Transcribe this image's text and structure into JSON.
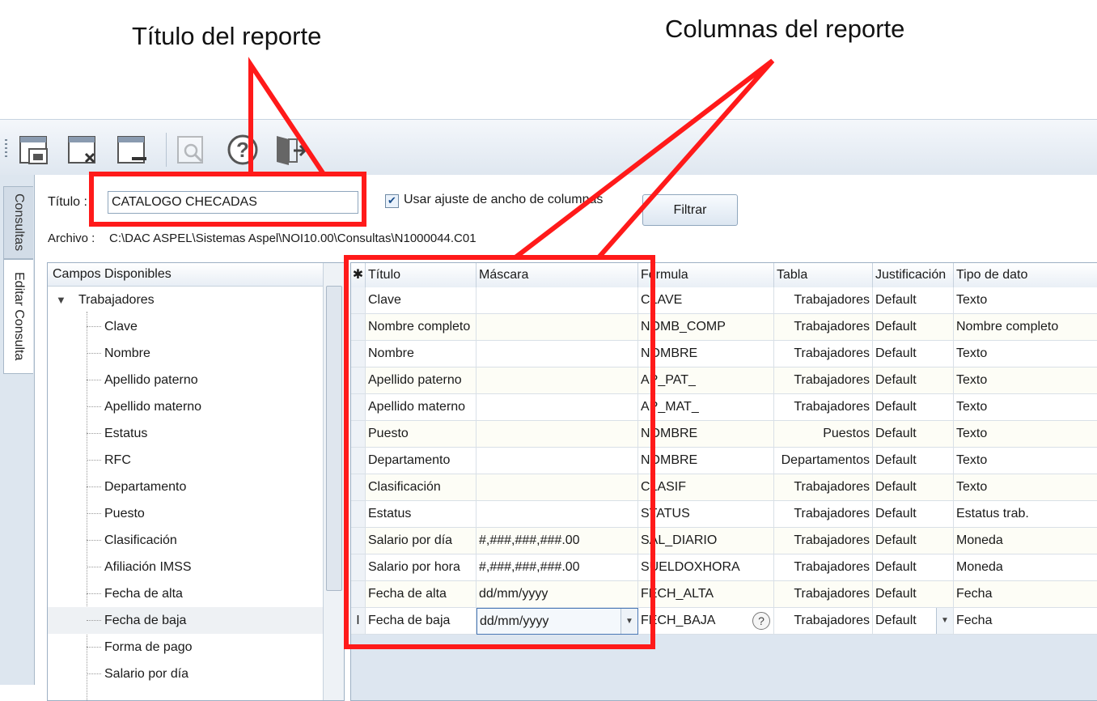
{
  "annotations": {
    "title_callout": "Título del reporte",
    "columns_callout": "Columnas del reporte"
  },
  "toolbar": {
    "icons": [
      "save-icon",
      "close-document-icon",
      "minimize-document-icon",
      "preview-icon",
      "help-icon",
      "exit-icon"
    ]
  },
  "sidebar": {
    "tab_consultas": "Consultas",
    "tab_editar": "Editar Consulta"
  },
  "form": {
    "titulo_label": "Título :",
    "titulo_value": "CATALOGO CHECADAS",
    "ajuste_label": "Usar ajuste de ancho de columnas",
    "ajuste_checked": true,
    "filtrar_label": "Filtrar",
    "archivo_label": "Archivo :",
    "archivo_path": "C:\\DAC ASPEL\\Sistemas Aspel\\NOI10.00\\Consultas\\N1000044.C01"
  },
  "tree": {
    "header": "Campos Disponibles",
    "root": "Trabajadores",
    "items": [
      "Clave",
      "Nombre",
      "Apellido paterno",
      "Apellido materno",
      "Estatus",
      "RFC",
      "Departamento",
      "Puesto",
      "Clasificación",
      "Afiliación IMSS",
      "Fecha de alta",
      "Fecha de baja",
      "Forma de pago",
      "Salario por día"
    ],
    "selected": "Fecha de baja"
  },
  "grid": {
    "new_row_marker": "✱",
    "edit_row_marker": "I",
    "headers": [
      "Título",
      "Máscara",
      "Formula",
      "Tabla",
      "Justificación",
      "Tipo de dato"
    ],
    "rows": [
      [
        "Clave",
        "",
        "CLAVE",
        "Trabajadores",
        "Default",
        "Texto"
      ],
      [
        "Nombre completo",
        "",
        "NOMB_COMP",
        "Trabajadores",
        "Default",
        "Nombre completo"
      ],
      [
        "Nombre",
        "",
        "NOMBRE",
        "Trabajadores",
        "Default",
        "Texto"
      ],
      [
        "Apellido paterno",
        "",
        "AP_PAT_",
        "Trabajadores",
        "Default",
        "Texto"
      ],
      [
        "Apellido materno",
        "",
        "AP_MAT_",
        "Trabajadores",
        "Default",
        "Texto"
      ],
      [
        "Puesto",
        "",
        "NOMBRE",
        "Puestos",
        "Default",
        "Texto"
      ],
      [
        "Departamento",
        "",
        "NOMBRE",
        "Departamentos",
        "Default",
        "Texto"
      ],
      [
        "Clasificación",
        "",
        "CLASIF",
        "Trabajadores",
        "Default",
        "Texto"
      ],
      [
        "Estatus",
        "",
        "STATUS",
        "Trabajadores",
        "Default",
        "Estatus trab."
      ],
      [
        "Salario por día",
        "#,###,###,###.00",
        "SAL_DIARIO",
        "Trabajadores",
        "Default",
        "Moneda"
      ],
      [
        "Salario por hora",
        "#,###,###,###.00",
        "SUELDOXHORA",
        "Trabajadores",
        "Default",
        "Moneda"
      ],
      [
        "Fecha de alta",
        "dd/mm/yyyy",
        "FECH_ALTA",
        "Trabajadores",
        "Default",
        "Fecha"
      ],
      [
        "Fecha de baja",
        "dd/mm/yyyy",
        "FECH_BAJA",
        "Trabajadores",
        "Default",
        "Fecha"
      ]
    ]
  },
  "colors": {
    "callout_red": "#ff1a1a"
  }
}
